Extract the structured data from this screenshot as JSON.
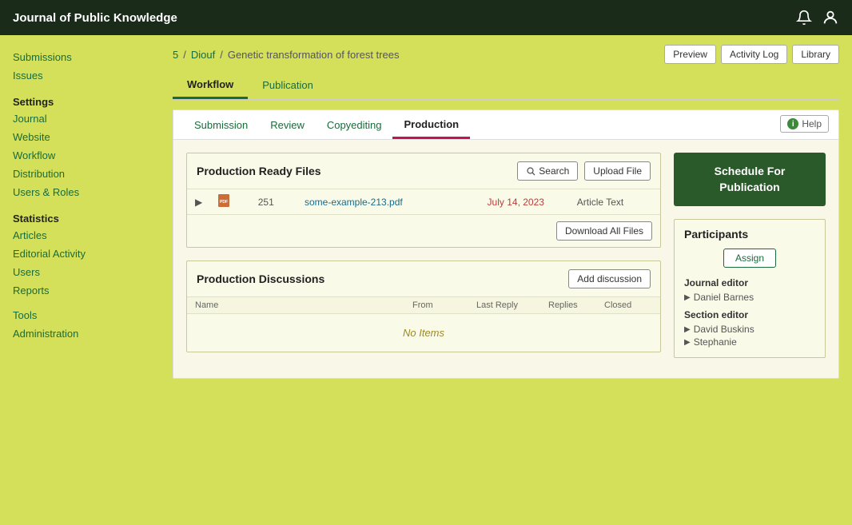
{
  "app": {
    "title": "Journal of Public Knowledge"
  },
  "header": {
    "notification_icon": "🔔",
    "user_icon": "👤",
    "breadcrumb": {
      "submission_id": "5",
      "author": "Diouf",
      "title": "Genetic transformation of forest trees"
    },
    "actions": {
      "preview": "Preview",
      "activity_log": "Activity Log",
      "library": "Library"
    }
  },
  "sidebar": {
    "nav_items": [
      {
        "label": "Submissions",
        "section": ""
      },
      {
        "label": "Issues",
        "section": ""
      }
    ],
    "settings": {
      "heading": "Settings",
      "items": [
        "Journal",
        "Website",
        "Workflow",
        "Distribution",
        "Users & Roles"
      ]
    },
    "statistics": {
      "heading": "Statistics",
      "items": [
        "Articles",
        "Editorial Activity",
        "Users",
        "Reports"
      ]
    },
    "tools": {
      "items": [
        "Tools",
        "Administration"
      ]
    }
  },
  "tabs_primary": [
    {
      "label": "Workflow",
      "active": true
    },
    {
      "label": "Publication",
      "active": false
    }
  ],
  "tabs_secondary": [
    {
      "label": "Submission",
      "active": false
    },
    {
      "label": "Review",
      "active": false
    },
    {
      "label": "Copyediting",
      "active": false
    },
    {
      "label": "Production",
      "active": true
    }
  ],
  "help_btn": "Help",
  "production_ready_files": {
    "title": "Production Ready Files",
    "search_btn": "Search",
    "upload_btn": "Upload File",
    "files": [
      {
        "id": "251",
        "name": "some-example-213.pdf",
        "date": "July 14, 2023",
        "type": "Article Text"
      }
    ],
    "download_all_btn": "Download All Files"
  },
  "production_discussions": {
    "title": "Production Discussions",
    "add_discussion_btn": "Add discussion",
    "columns": {
      "name": "Name",
      "from": "From",
      "last_reply": "Last Reply",
      "replies": "Replies",
      "closed": "Closed"
    },
    "no_items": "No Items"
  },
  "schedule_btn_line1": "Schedule For",
  "schedule_btn_line2": "Publication",
  "participants": {
    "title": "Participants",
    "assign_btn": "Assign",
    "roles": [
      {
        "role": "Journal editor",
        "members": [
          "Daniel Barnes"
        ]
      },
      {
        "role": "Section editor",
        "members": [
          "David Buskins",
          "Stephanie"
        ]
      }
    ]
  }
}
